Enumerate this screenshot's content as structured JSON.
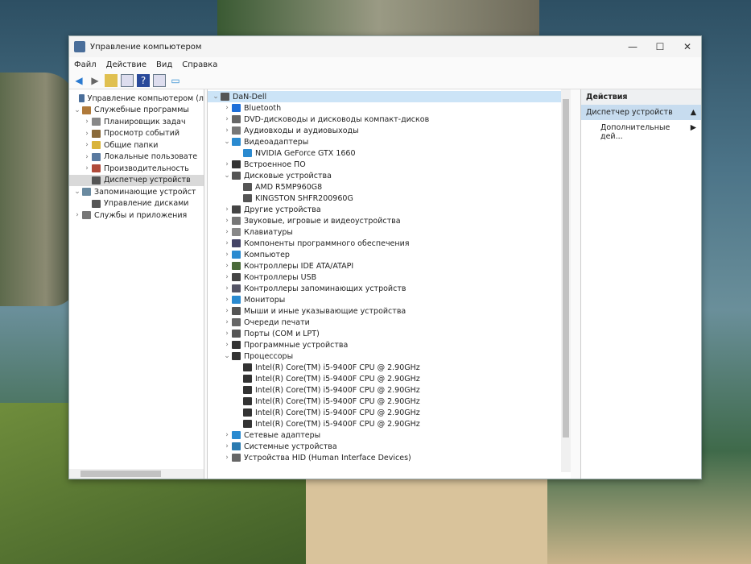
{
  "window": {
    "title": "Управление компьютером",
    "min": "—",
    "max": "☐",
    "close": "✕"
  },
  "menu": [
    "Файл",
    "Действие",
    "Вид",
    "Справка"
  ],
  "toolbar": [
    "back-icon",
    "forward-icon",
    "up-folder-icon",
    "show-hide-tree-icon",
    "help-icon",
    "properties-icon",
    "monitor-icon"
  ],
  "left_tree": [
    {
      "label": "Управление компьютером (л",
      "level": 0,
      "chev": "",
      "color": "#4a6e9a"
    },
    {
      "label": "Служебные программы",
      "level": 0,
      "chev": "v",
      "color": "#b07a3a"
    },
    {
      "label": "Планировщик задач",
      "level": 1,
      "chev": ">",
      "color": "#888"
    },
    {
      "label": "Просмотр событий",
      "level": 1,
      "chev": ">",
      "color": "#8a6a3a"
    },
    {
      "label": "Общие папки",
      "level": 1,
      "chev": ">",
      "color": "#d9b43a"
    },
    {
      "label": "Локальные пользовате",
      "level": 1,
      "chev": ">",
      "color": "#5a7aa0"
    },
    {
      "label": "Производительность",
      "level": 1,
      "chev": ">",
      "color": "#b04a3a"
    },
    {
      "label": "Диспетчер устройств",
      "level": 1,
      "chev": "",
      "color": "#555",
      "selected": true
    },
    {
      "label": "Запоминающие устройст",
      "level": 0,
      "chev": "v",
      "color": "#6a8aa0"
    },
    {
      "label": "Управление дисками",
      "level": 1,
      "chev": "",
      "color": "#555"
    },
    {
      "label": "Службы и приложения",
      "level": 0,
      "chev": ">",
      "color": "#777"
    }
  ],
  "device_tree": [
    {
      "label": "DaN-Dell",
      "level": 0,
      "chev": "v",
      "color": "#555",
      "selected": true
    },
    {
      "label": "Bluetooth",
      "level": 1,
      "chev": ">",
      "color": "#1e6fd9"
    },
    {
      "label": "DVD-дисководы и дисководы компакт-дисков",
      "level": 1,
      "chev": ">",
      "color": "#666"
    },
    {
      "label": "Аудиовходы и аудиовыходы",
      "level": 1,
      "chev": ">",
      "color": "#777"
    },
    {
      "label": "Видеоадаптеры",
      "level": 1,
      "chev": "v",
      "color": "#2a8ad0"
    },
    {
      "label": "NVIDIA GeForce GTX 1660",
      "level": 2,
      "chev": "",
      "color": "#2a8ad0"
    },
    {
      "label": "Встроенное ПО",
      "level": 1,
      "chev": ">",
      "color": "#333"
    },
    {
      "label": "Дисковые устройства",
      "level": 1,
      "chev": "v",
      "color": "#555"
    },
    {
      "label": "AMD R5MP960G8",
      "level": 2,
      "chev": "",
      "color": "#555"
    },
    {
      "label": "KINGSTON SHFR200960G",
      "level": 2,
      "chev": "",
      "color": "#555"
    },
    {
      "label": "Другие устройства",
      "level": 1,
      "chev": ">",
      "color": "#444"
    },
    {
      "label": "Звуковые, игровые и видеоустройства",
      "level": 1,
      "chev": ">",
      "color": "#777"
    },
    {
      "label": "Клавиатуры",
      "level": 1,
      "chev": ">",
      "color": "#888"
    },
    {
      "label": "Компоненты программного обеспечения",
      "level": 1,
      "chev": ">",
      "color": "#446"
    },
    {
      "label": "Компьютер",
      "level": 1,
      "chev": ">",
      "color": "#2a8ad0"
    },
    {
      "label": "Контроллеры IDE ATA/ATAPI",
      "level": 1,
      "chev": ">",
      "color": "#4a6a3a"
    },
    {
      "label": "Контроллеры USB",
      "level": 1,
      "chev": ">",
      "color": "#444"
    },
    {
      "label": "Контроллеры запоминающих устройств",
      "level": 1,
      "chev": ">",
      "color": "#556"
    },
    {
      "label": "Мониторы",
      "level": 1,
      "chev": ">",
      "color": "#2a8ad0"
    },
    {
      "label": "Мыши и иные указывающие устройства",
      "level": 1,
      "chev": ">",
      "color": "#555"
    },
    {
      "label": "Очереди печати",
      "level": 1,
      "chev": ">",
      "color": "#666"
    },
    {
      "label": "Порты (COM и LPT)",
      "level": 1,
      "chev": ">",
      "color": "#555"
    },
    {
      "label": "Программные устройства",
      "level": 1,
      "chev": ">",
      "color": "#333"
    },
    {
      "label": "Процессоры",
      "level": 1,
      "chev": "v",
      "color": "#333"
    },
    {
      "label": "Intel(R) Core(TM) i5-9400F CPU @ 2.90GHz",
      "level": 2,
      "chev": "",
      "color": "#333"
    },
    {
      "label": "Intel(R) Core(TM) i5-9400F CPU @ 2.90GHz",
      "level": 2,
      "chev": "",
      "color": "#333"
    },
    {
      "label": "Intel(R) Core(TM) i5-9400F CPU @ 2.90GHz",
      "level": 2,
      "chev": "",
      "color": "#333"
    },
    {
      "label": "Intel(R) Core(TM) i5-9400F CPU @ 2.90GHz",
      "level": 2,
      "chev": "",
      "color": "#333"
    },
    {
      "label": "Intel(R) Core(TM) i5-9400F CPU @ 2.90GHz",
      "level": 2,
      "chev": "",
      "color": "#333"
    },
    {
      "label": "Intel(R) Core(TM) i5-9400F CPU @ 2.90GHz",
      "level": 2,
      "chev": "",
      "color": "#333"
    },
    {
      "label": "Сетевые адаптеры",
      "level": 1,
      "chev": ">",
      "color": "#2a8ad0"
    },
    {
      "label": "Системные устройства",
      "level": 1,
      "chev": ">",
      "color": "#2a7ab0"
    },
    {
      "label": "Устройства HID (Human Interface Devices)",
      "level": 1,
      "chev": ">",
      "color": "#666"
    }
  ],
  "actions": {
    "header": "Действия",
    "section": "Диспетчер устройств",
    "more": "Дополнительные дей...",
    "section_arrow": "▲",
    "more_arrow": "▶"
  }
}
